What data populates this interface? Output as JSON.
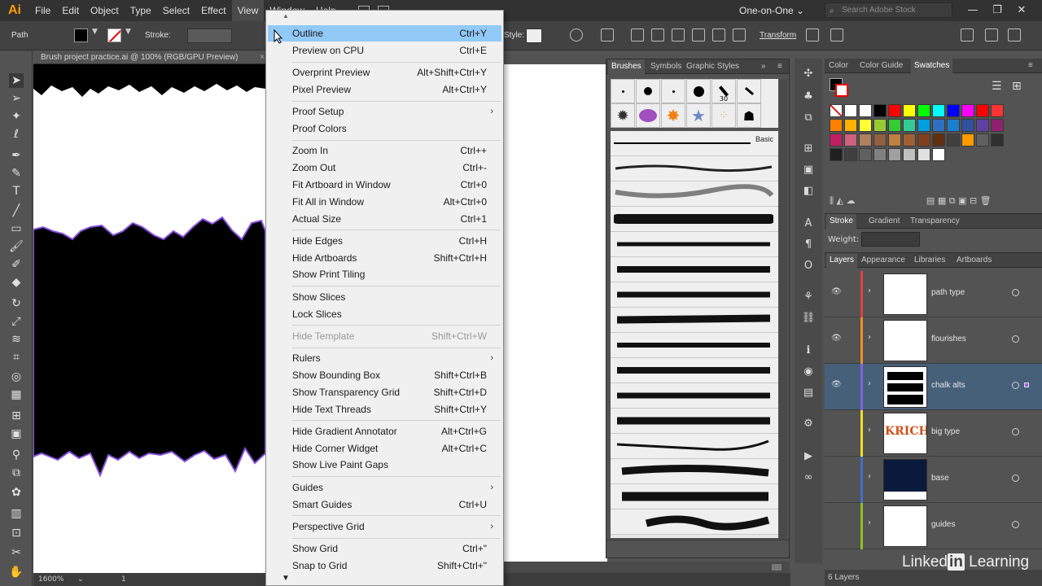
{
  "app": {
    "logo": "Ai",
    "menus": [
      "File",
      "Edit",
      "Object",
      "Type",
      "Select",
      "Effect",
      "View",
      "Window",
      "Help"
    ],
    "active_menu": "View",
    "workspace": "One-on-One",
    "workspace_caret": "⌄",
    "search_placeholder": "Search Adobe Stock",
    "window_buttons": [
      "—",
      "❐",
      "✕"
    ]
  },
  "control_bar": {
    "selection_type": "Path",
    "stroke_label": "Stroke:",
    "style_label": "Style:",
    "transform_label": "Transform"
  },
  "document": {
    "tab_title": "Brush project practice.ai @ 100% (RGB/GPU Preview)",
    "close_glyph": "×",
    "zoom": "1600%",
    "artboard_num": "1"
  },
  "view_menu": {
    "items": [
      {
        "label": "Outline",
        "shortcut": "Ctrl+Y",
        "highlighted": true
      },
      {
        "label": "Preview on CPU",
        "shortcut": "Ctrl+E"
      },
      {
        "sep": true
      },
      {
        "label": "Overprint Preview",
        "shortcut": "Alt+Shift+Ctrl+Y"
      },
      {
        "label": "Pixel Preview",
        "shortcut": "Alt+Ctrl+Y"
      },
      {
        "sep": true
      },
      {
        "label": "Proof Setup",
        "submenu": true
      },
      {
        "label": "Proof Colors",
        "shortcut": ""
      },
      {
        "sep": true
      },
      {
        "label": "Zoom In",
        "shortcut": "Ctrl++"
      },
      {
        "label": "Zoom Out",
        "shortcut": "Ctrl+-"
      },
      {
        "label": "Fit Artboard in Window",
        "shortcut": "Ctrl+0"
      },
      {
        "label": "Fit All in Window",
        "shortcut": "Alt+Ctrl+0"
      },
      {
        "label": "Actual Size",
        "shortcut": "Ctrl+1"
      },
      {
        "sep": true
      },
      {
        "label": "Hide Edges",
        "shortcut": "Ctrl+H"
      },
      {
        "label": "Hide Artboards",
        "shortcut": "Shift+Ctrl+H"
      },
      {
        "label": "Show Print Tiling",
        "shortcut": ""
      },
      {
        "sep": true
      },
      {
        "label": "Show Slices",
        "shortcut": ""
      },
      {
        "label": "Lock Slices",
        "shortcut": ""
      },
      {
        "sep": true
      },
      {
        "label": "Hide Template",
        "shortcut": "Shift+Ctrl+W",
        "disabled": true
      },
      {
        "sep": true
      },
      {
        "label": "Rulers",
        "submenu": true
      },
      {
        "label": "Show Bounding Box",
        "shortcut": "Shift+Ctrl+B"
      },
      {
        "label": "Show Transparency Grid",
        "shortcut": "Shift+Ctrl+D"
      },
      {
        "label": "Hide Text Threads",
        "shortcut": "Shift+Ctrl+Y"
      },
      {
        "sep": true
      },
      {
        "label": "Hide Gradient Annotator",
        "shortcut": "Alt+Ctrl+G"
      },
      {
        "label": "Hide Corner Widget",
        "shortcut": "Alt+Ctrl+C"
      },
      {
        "label": "Show Live Paint Gaps",
        "shortcut": ""
      },
      {
        "sep": true
      },
      {
        "label": "Guides",
        "submenu": true
      },
      {
        "label": "Smart Guides",
        "shortcut": "Ctrl+U"
      },
      {
        "sep": true
      },
      {
        "label": "Perspective Grid",
        "submenu": true
      },
      {
        "sep": true
      },
      {
        "label": "Show Grid",
        "shortcut": "Ctrl+\""
      },
      {
        "label": "Snap to Grid",
        "shortcut": "Shift+Ctrl+\""
      }
    ]
  },
  "brushes_panel": {
    "tabs": [
      "Brushes",
      "Symbols",
      "Graphic Styles"
    ],
    "basic_label": "Basic",
    "size_badge": "30"
  },
  "color_panel": {
    "tabs": [
      "Color",
      "Color Guide",
      "Swatches"
    ],
    "swatches": [
      "#ff0000",
      "#ffff00",
      "#00ff00",
      "#00ffff",
      "#0000ff",
      "#ff00ff",
      "#ff0000",
      "#ff3333",
      "#ff8000",
      "#ffb000",
      "#ffff33",
      "#99cc33",
      "#33cc33",
      "#33cc99",
      "#00a0e0",
      "#3070c0",
      "#1a7fd0",
      "#3050a0",
      "#6040a0",
      "#902070",
      "#c02060",
      "#d06080",
      "#b08060",
      "#906040",
      "#c08040",
      "#a06030",
      "#804020",
      "#603010",
      "#404040",
      "#ff9900",
      "#606060",
      "#303030",
      "#202020",
      "#404040",
      "#606060",
      "#808080",
      "#a0a0a0",
      "#c0c0c0",
      "#e0e0e0",
      "#ffffff"
    ]
  },
  "stroke_panel": {
    "tabs": [
      "Stroke",
      "Gradient",
      "Transparency"
    ],
    "weight_label": "Weight:"
  },
  "layers_panel": {
    "tabs": [
      "Layers",
      "Appearance",
      "Libraries",
      "Artboards"
    ],
    "layers": [
      {
        "name": "path type",
        "color": "#e04040"
      },
      {
        "name": "flourishes",
        "color": "#f09020"
      },
      {
        "name": "chalk alts",
        "color": "#8060e0",
        "selected": true
      },
      {
        "name": "big type",
        "color": "#f0e020"
      },
      {
        "name": "base",
        "color": "#4070d0"
      },
      {
        "name": "guides",
        "color": "#90c020"
      }
    ],
    "thumb_big_type": "KRICH",
    "count_label": "6 Layers"
  },
  "watermark": {
    "prefix": "Linked",
    "in": "in",
    "suffix": " Learning"
  }
}
